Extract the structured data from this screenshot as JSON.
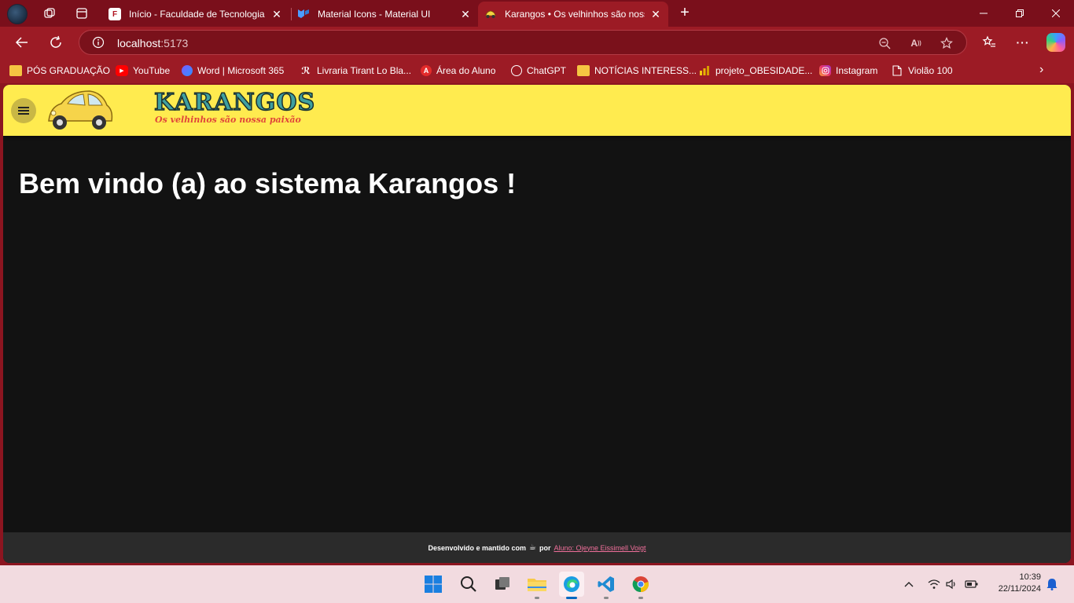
{
  "browser": {
    "tabs": [
      {
        "title": "Início - Faculdade de Tecnologia de",
        "favicon": "F",
        "active": false
      },
      {
        "title": "Material Icons - Material UI",
        "favicon": "MUI",
        "active": false
      },
      {
        "title": "Karangos • Os velhinhos são nossa paixão",
        "favicon": "car",
        "active": true
      }
    ],
    "address": {
      "host": "localhost",
      "port": ":5173"
    },
    "bookmarks": [
      {
        "label": "PÓS GRADUAÇÃO",
        "icon": "folder-icon"
      },
      {
        "label": "YouTube",
        "icon": "youtube-icon"
      },
      {
        "label": "Word | Microsoft 365",
        "icon": "word-icon"
      },
      {
        "label": "Livraria Tirant Lo Bla...",
        "icon": "tirant-icon"
      },
      {
        "label": "Área do Aluno",
        "icon": "aluno-icon"
      },
      {
        "label": "ChatGPT",
        "icon": "chatgpt-icon"
      },
      {
        "label": "NOTÍCIAS INTERESS...",
        "icon": "folder-icon"
      },
      {
        "label": "projeto_OBESIDADE...",
        "icon": "powerbi-icon"
      },
      {
        "label": "Instagram",
        "icon": "instagram-icon"
      },
      {
        "label": "Violão 100",
        "icon": "page-icon"
      }
    ]
  },
  "app": {
    "brand": "KARANGOS",
    "tagline": "Os velhinhos são nossa paixão",
    "welcome": "Bem vindo (a) ao sistema Karangos !",
    "footer": {
      "text": "Desenvolvido e mantido com",
      "by": "por",
      "author_link": "Aluno: Ojeyne Eissimell Voigt"
    },
    "colors": {
      "appbar": "#ffeb4f",
      "background": "#121212",
      "footer": "#2b2b2b",
      "link": "#ef6f9a"
    }
  },
  "taskbar": {
    "time": "10:39",
    "date": "22/11/2024"
  }
}
